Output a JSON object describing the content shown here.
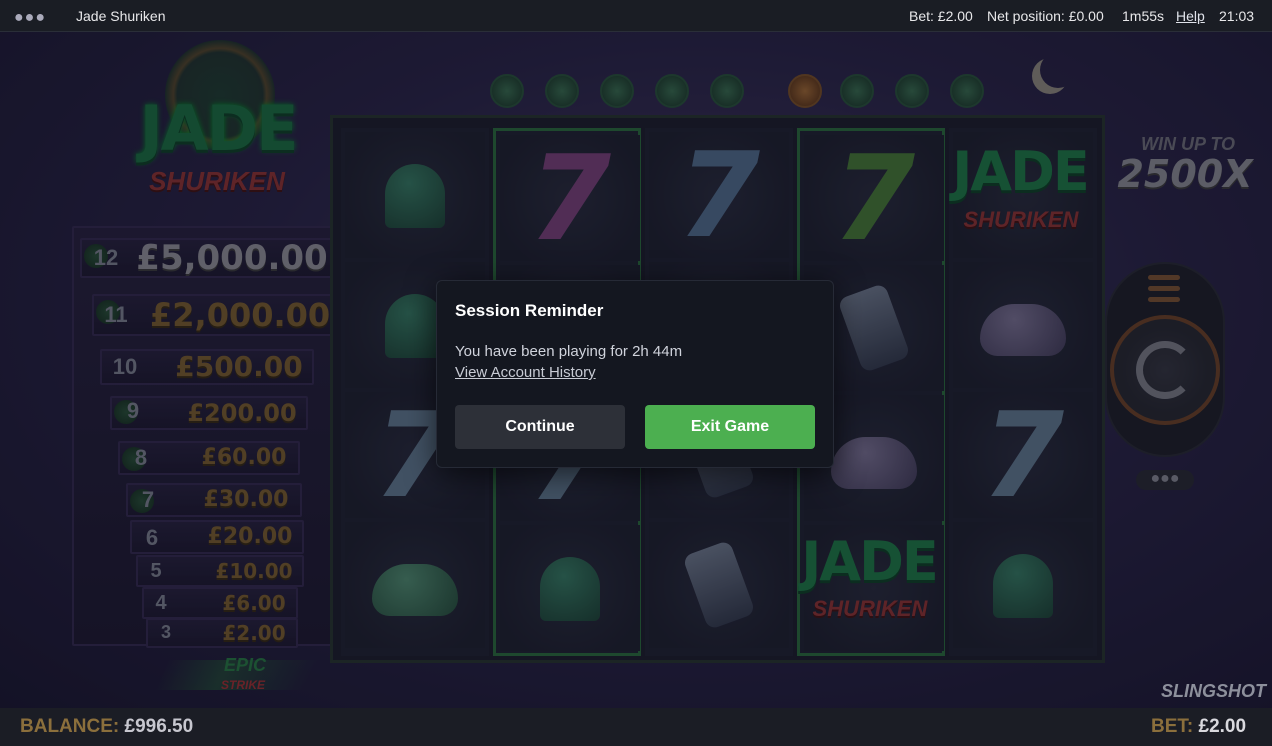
{
  "topbar": {
    "menu_icon": "ellipsis-icon",
    "title": "Jade Shuriken",
    "bet": "Bet: £2.00",
    "net_position": "Net position: £0.00",
    "timer": "1m55s",
    "help": "Help",
    "clock": "21:03"
  },
  "logo": {
    "jade": "JADE",
    "shuriken": "SHURIKEN"
  },
  "paytable": [
    {
      "count": "12",
      "amount": "£5,000.00"
    },
    {
      "count": "11",
      "amount": "£2,000.00"
    },
    {
      "count": "10",
      "amount": "£500.00"
    },
    {
      "count": "9",
      "amount": "£200.00"
    },
    {
      "count": "8",
      "amount": "£60.00"
    },
    {
      "count": "7",
      "amount": "£30.00"
    },
    {
      "count": "6",
      "amount": "£20.00"
    },
    {
      "count": "5",
      "amount": "£10.00"
    },
    {
      "count": "4",
      "amount": "£6.00"
    },
    {
      "count": "3",
      "amount": "£2.00"
    }
  ],
  "epic_strike": {
    "epic": "EPIC",
    "strike": "STRIKE"
  },
  "reel_logo": {
    "jade": "JADE",
    "shuriken": "SHURIKEN"
  },
  "reel_logo2": {
    "jade": "JADE",
    "shuriken": "SHURIKEN"
  },
  "win": {
    "upto": "WIN UP TO",
    "multiplier": "2500X"
  },
  "modal": {
    "title": "Session Reminder",
    "message": "You have been playing for 2h 44m",
    "link": "View Account History",
    "continue": "Continue",
    "exit": "Exit Game"
  },
  "bottom": {
    "balance_label": "BALANCE:",
    "balance_value": "£996.50",
    "bet_label": "BET:",
    "bet_value": "£2.00"
  },
  "brand": {
    "slingshot": "SLINGSHOT"
  },
  "colors": {
    "accent_green": "#4caf50",
    "panel": "#141720"
  }
}
